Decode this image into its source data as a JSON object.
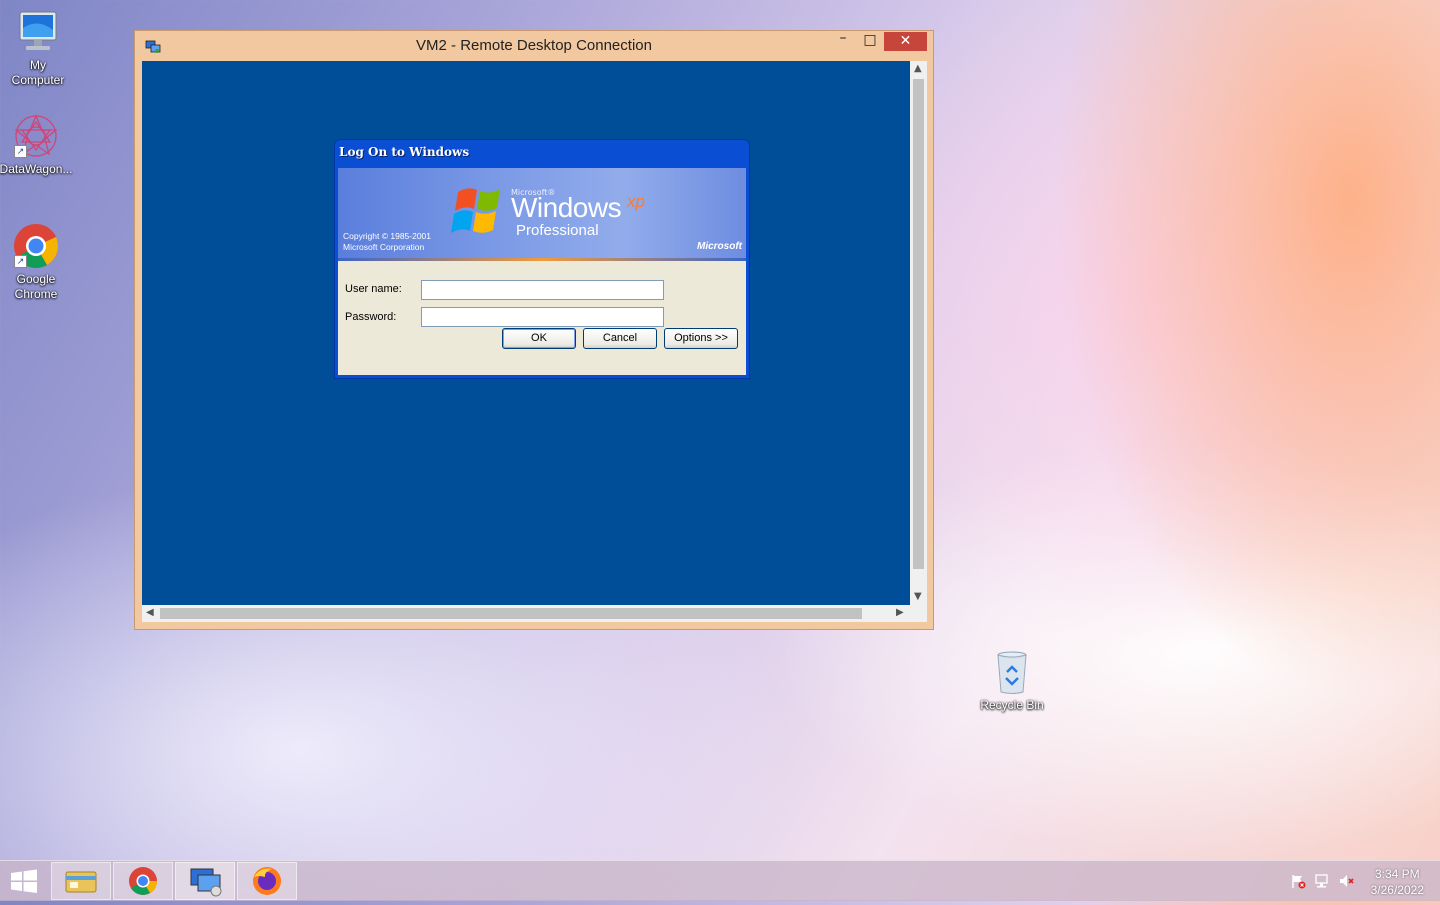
{
  "desktop": {
    "icons": [
      {
        "label": "My\nComputer",
        "icon": "my-computer-icon"
      },
      {
        "label": "DataWagon...",
        "icon": "datawagon-icon"
      },
      {
        "label": "Google\nChrome",
        "icon": "chrome-icon"
      },
      {
        "label": "Recycle Bin",
        "icon": "recycle-bin-icon"
      }
    ]
  },
  "rdp_window": {
    "title": "VM2 - Remote Desktop Connection",
    "minimize": "–",
    "maximize": "□",
    "close": "✕"
  },
  "logon_dialog": {
    "title": "Log On to Windows",
    "banner": {
      "brand_small": "Microsoft®",
      "product": "Windows",
      "edition_suffix": "xp",
      "edition": "Professional",
      "copyright_line1": "Copyright © 1985-2001",
      "copyright_line2": "Microsoft Corporation",
      "vendor": "Microsoft"
    },
    "username_label": "User name:",
    "username_value": "",
    "password_label": "Password:",
    "password_value": "",
    "ok_label": "OK",
    "cancel_label": "Cancel",
    "options_label": "Options >>"
  },
  "taskbar": {
    "pinned": [
      "file-explorer-icon",
      "chrome-icon",
      "remote-desktop-icon",
      "firefox-icon"
    ],
    "clock_time": "3:34 PM",
    "clock_date": "3/26/2022"
  },
  "colors": {
    "rdp_background": "#004e98",
    "xp_title_bar": "#0a4fd3",
    "window_frame": "#f2c8a0",
    "close_button": "#c7463c"
  }
}
